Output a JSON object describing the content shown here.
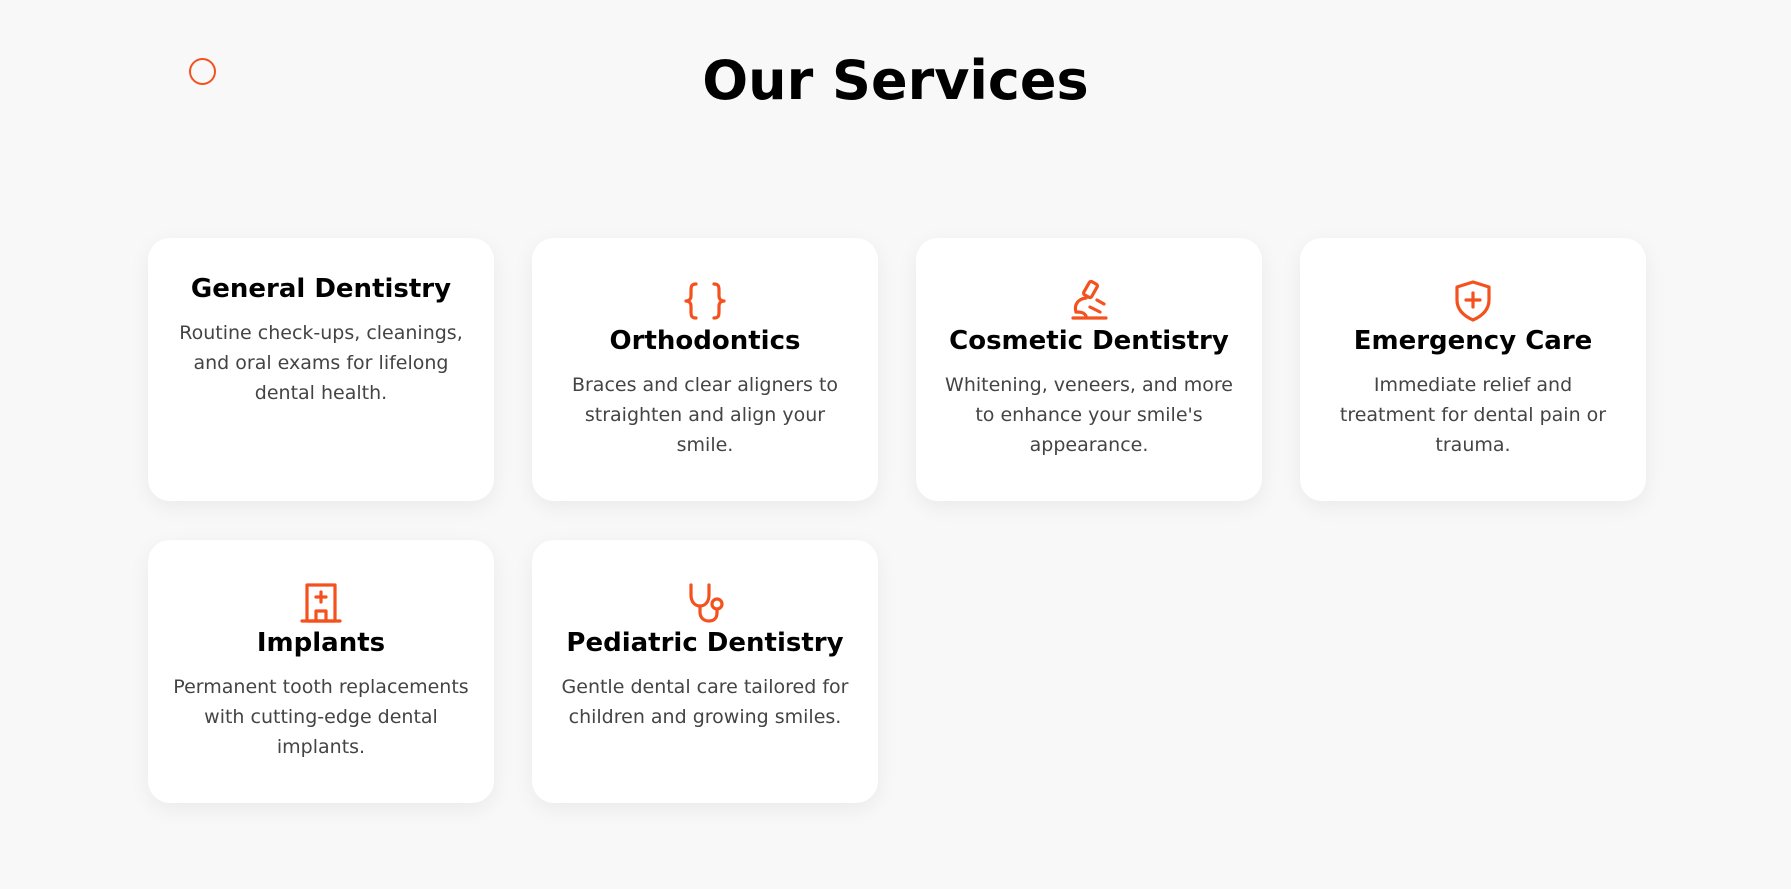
{
  "page": {
    "title": "Our Services",
    "accent_color": "#f4511e"
  },
  "services": [
    {
      "title": "General Dentistry",
      "text": "Routine check-ups, cleanings, and oral exams for lifelong dental health.",
      "icon": "none"
    },
    {
      "title": "Orthodontics",
      "text": "Braces and clear aligners to straighten and align your smile.",
      "icon": "curly-braces-icon"
    },
    {
      "title": "Cosmetic Dentistry",
      "text": "Whitening, veneers, and more to enhance your smile's appearance.",
      "icon": "microscope-icon"
    },
    {
      "title": "Emergency Care",
      "text": "Immediate relief and treatment for dental pain or trauma.",
      "icon": "shield-plus-icon"
    },
    {
      "title": "Implants",
      "text": "Permanent tooth replacements with cutting-edge dental implants.",
      "icon": "hospital-icon"
    },
    {
      "title": "Pediatric Dentistry",
      "text": "Gentle dental care tailored for children and growing smiles.",
      "icon": "stethoscope-icon"
    }
  ]
}
